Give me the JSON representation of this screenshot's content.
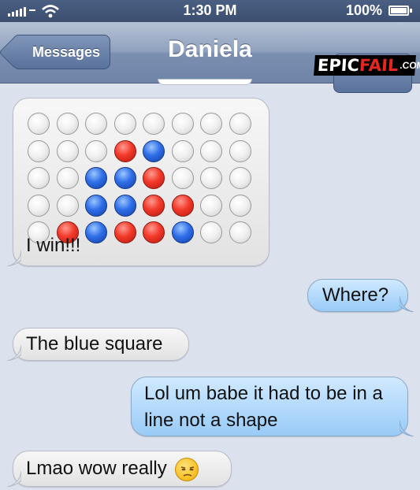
{
  "status_bar": {
    "time": "1:30 PM",
    "battery": "100%"
  },
  "nav": {
    "back_label": "Messages",
    "title": "Daniela"
  },
  "watermark": {
    "epic": "EPIC",
    "fail": "FAIL",
    "dotcom": ".COM"
  },
  "board": {
    "rows": [
      [
        "empty",
        "empty",
        "empty",
        "empty",
        "empty",
        "empty",
        "empty",
        "empty"
      ],
      [
        "empty",
        "empty",
        "empty",
        "red",
        "blue",
        "empty",
        "empty",
        "empty"
      ],
      [
        "empty",
        "empty",
        "blue",
        "blue",
        "red",
        "empty",
        "empty",
        "empty"
      ],
      [
        "empty",
        "empty",
        "blue",
        "blue",
        "red",
        "red",
        "empty",
        "empty"
      ],
      [
        "empty",
        "red",
        "blue",
        "red",
        "red",
        "blue",
        "empty",
        "empty"
      ]
    ]
  },
  "messages": [
    {
      "from": "them",
      "text": "I win!!!"
    },
    {
      "from": "me",
      "text": "Where?"
    },
    {
      "from": "them",
      "text": "The blue square"
    },
    {
      "from": "me",
      "text": "Lol um babe it had to be in a line not a shape"
    },
    {
      "from": "them",
      "text": "Lmao wow really",
      "emoji": "unamused-face"
    }
  ],
  "colors": {
    "incoming_bubble": "#eeeeee",
    "outgoing_bubble": "#a9d4fa",
    "red_disc": "#f3392a",
    "blue_disc": "#2f6ee8",
    "background": "#dbe2ed"
  }
}
